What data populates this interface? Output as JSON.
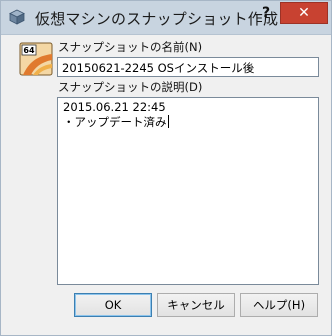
{
  "window": {
    "title": "仮想マシンのスナップショット作成",
    "help_label": "?",
    "close_label": "✕"
  },
  "form": {
    "name_label": "スナップショットの名前(N)",
    "name_value": "20150621-2245 OSインストール後",
    "description_label": "スナップショットの説明(D)",
    "description_lines": [
      "2015.06.21 22:45",
      "・アップデート済み"
    ]
  },
  "buttons": {
    "ok": "OK",
    "cancel": "キャンセル",
    "help": "ヘルプ(H)"
  },
  "icons": {
    "app": "virtualbox-cube-icon",
    "snapshot": "snapshot-64-icon",
    "snapshot_badge": "64"
  },
  "colors": {
    "titlebar": "#c8d4e0",
    "close_button": "#c84231",
    "dialog_bg": "#f0f0f0",
    "default_button_border": "#3c7fb1"
  }
}
